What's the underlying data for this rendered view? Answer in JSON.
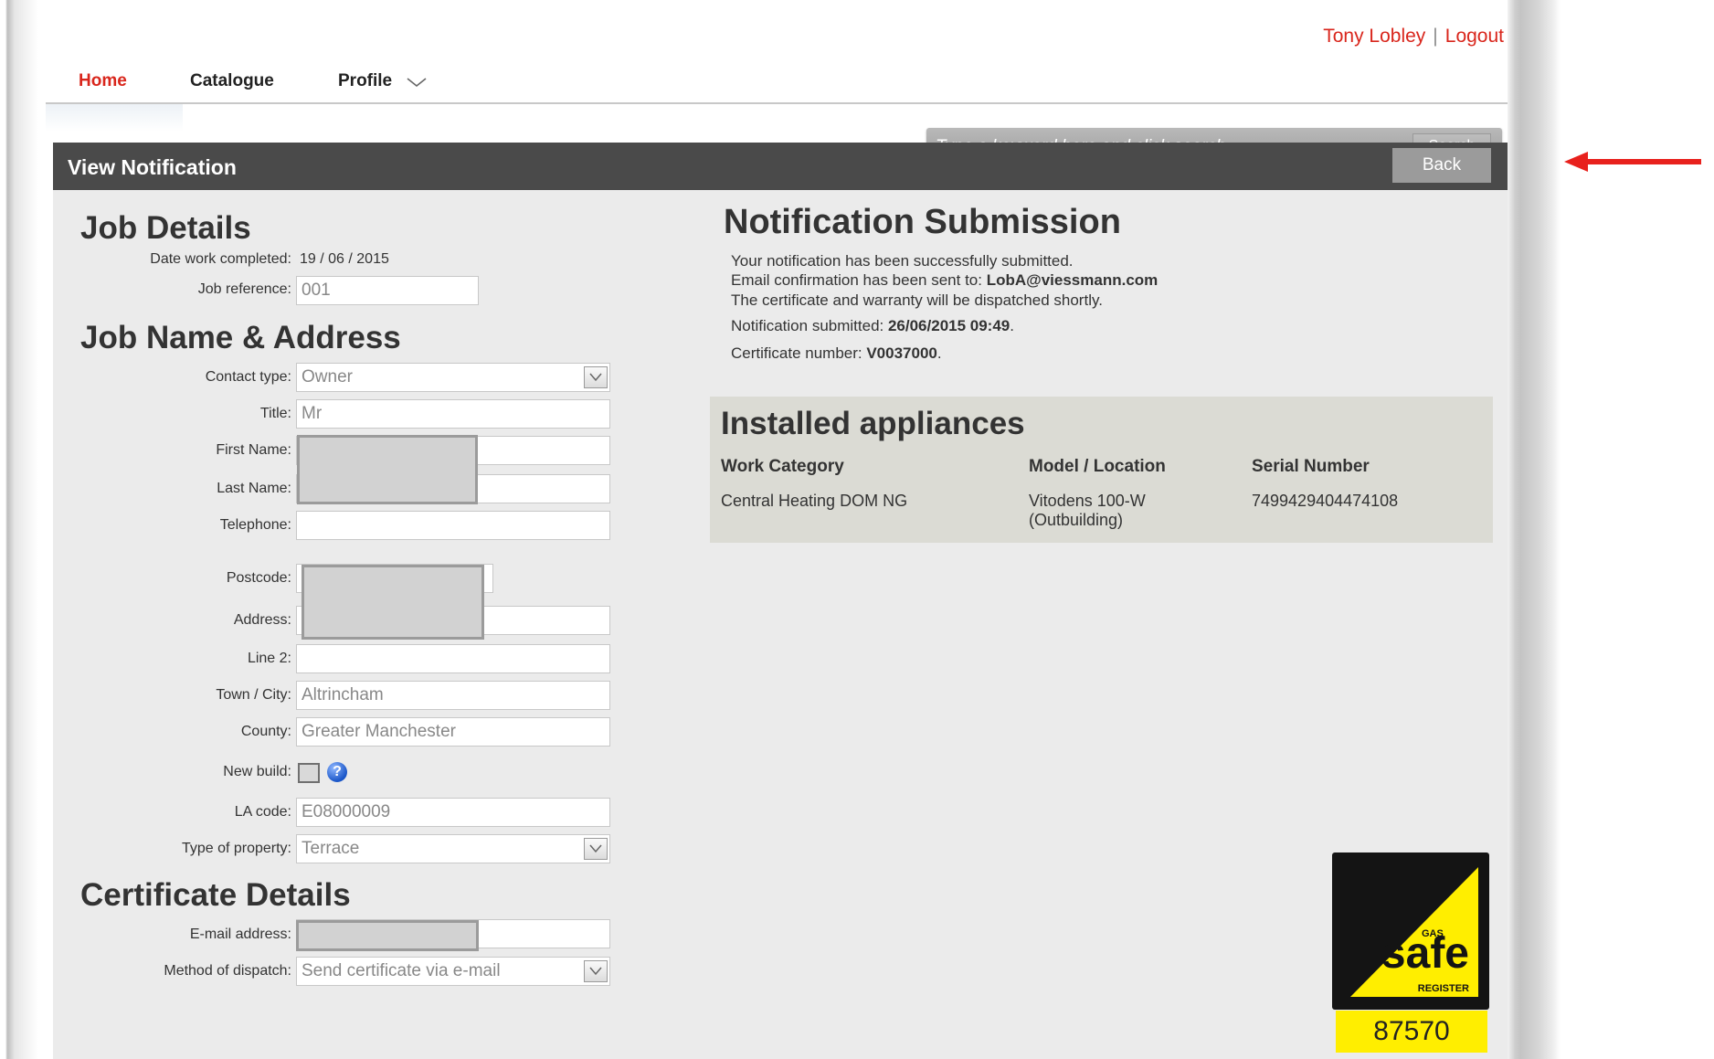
{
  "header": {
    "user_name": "Tony Lobley",
    "separator": "|",
    "logout": "Logout"
  },
  "nav": {
    "items": [
      "Home",
      "Catalogue",
      "Profile"
    ],
    "active": "Home"
  },
  "search": {
    "placeholder": "Type a keyword here and click search",
    "button": "Search"
  },
  "view_bar": {
    "title": "View Notification",
    "back": "Back"
  },
  "job_details": {
    "heading": "Job Details",
    "date_label": "Date work completed:",
    "date_value": "19 / 06 / 2015",
    "ref_label": "Job reference:",
    "ref_value": "001"
  },
  "job_address": {
    "heading": "Job Name & Address",
    "contact_type_label": "Contact type:",
    "contact_type_value": "Owner",
    "title_label": "Title:",
    "title_value": "Mr",
    "first_name_label": "First Name:",
    "last_name_label": "Last Name:",
    "telephone_label": "Telephone:",
    "postcode_label": "Postcode:",
    "address_label": "Address:",
    "line2_label": "Line 2:",
    "town_label": "Town / City:",
    "town_value": "Altrincham",
    "county_label": "County:",
    "county_value": "Greater Manchester",
    "new_build_label": "New build:",
    "new_build_checked": false,
    "la_code_label": "LA code:",
    "la_code_value": "E08000009",
    "property_label": "Type of property:",
    "property_value": "Terrace"
  },
  "certificate": {
    "heading": "Certificate Details",
    "email_label": "E-mail address:",
    "dispatch_label": "Method of dispatch:",
    "dispatch_value": "Send certificate via e-mail"
  },
  "notification": {
    "heading": "Notification Submission",
    "line1": "Your notification has been successfully submitted.",
    "line2_prefix": "Email confirmation has been sent to: ",
    "email": "LobA@viessmann.com",
    "line3": "The certificate and warranty will be dispatched shortly.",
    "submitted_label": "Notification submitted: ",
    "submitted_value": "26/06/2015 09:49",
    "cert_label": "Certificate number: ",
    "cert_value": "V0037000"
  },
  "appliances": {
    "heading": "Installed appliances",
    "columns": [
      "Work Category",
      "Model / Location",
      "Serial Number"
    ],
    "rows": [
      {
        "work_category": "Central Heating DOM NG",
        "model": "Vitodens 100-W",
        "location": "(Outbuilding)",
        "serial": "7499429404474108"
      }
    ]
  },
  "gas_safe": {
    "logo_text": "safe",
    "gas_text": "GAS",
    "register_text": "REGISTER",
    "number": "87570"
  },
  "colors": {
    "accent_red": "#d9261c",
    "bar_dark": "#4a4a4a",
    "gas_yellow": "#ffee00"
  }
}
